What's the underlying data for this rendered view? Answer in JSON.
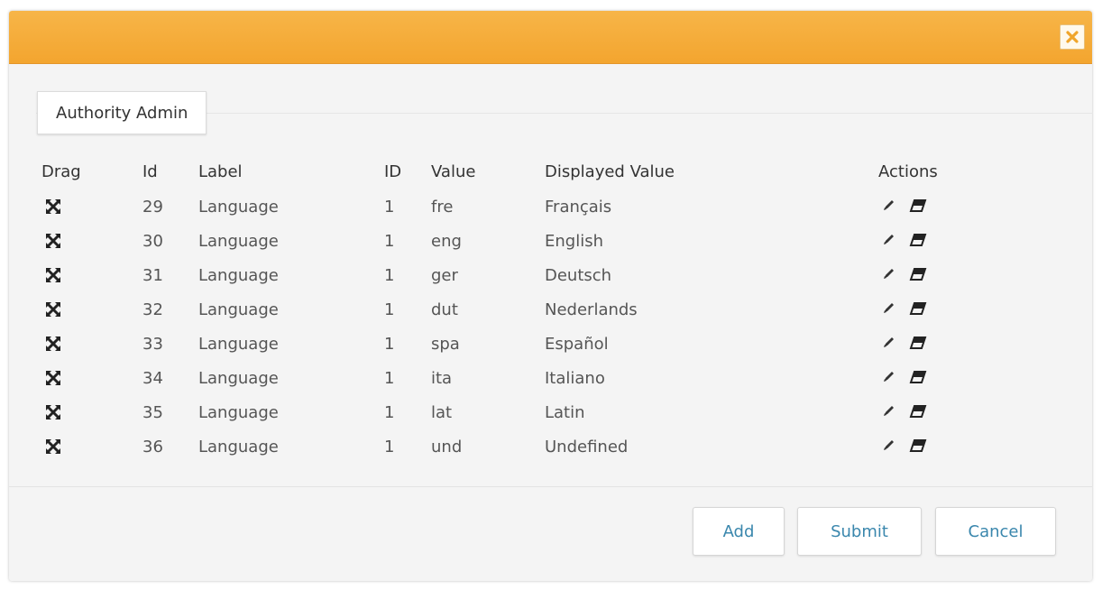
{
  "dialog": {
    "close_icon": "close-icon",
    "colors": {
      "titlebar": "#f4a933",
      "link": "#3a87ad"
    }
  },
  "tab": {
    "label": "Authority Admin"
  },
  "table": {
    "headers": {
      "drag": "Drag",
      "id": "Id",
      "label": "Label",
      "ID": "ID",
      "value": "Value",
      "displayed_value": "Displayed Value",
      "actions": "Actions"
    },
    "rows": [
      {
        "id": "29",
        "label": "Language",
        "ID": "1",
        "value": "fre",
        "displayed_value": "Français"
      },
      {
        "id": "30",
        "label": "Language",
        "ID": "1",
        "value": "eng",
        "displayed_value": "English"
      },
      {
        "id": "31",
        "label": "Language",
        "ID": "1",
        "value": "ger",
        "displayed_value": "Deutsch"
      },
      {
        "id": "32",
        "label": "Language",
        "ID": "1",
        "value": "dut",
        "displayed_value": "Nederlands"
      },
      {
        "id": "33",
        "label": "Language",
        "ID": "1",
        "value": "spa",
        "displayed_value": "Español"
      },
      {
        "id": "34",
        "label": "Language",
        "ID": "1",
        "value": "ita",
        "displayed_value": "Italiano"
      },
      {
        "id": "35",
        "label": "Language",
        "ID": "1",
        "value": "lat",
        "displayed_value": "Latin"
      },
      {
        "id": "36",
        "label": "Language",
        "ID": "1",
        "value": "und",
        "displayed_value": "Undefined"
      }
    ],
    "icons": {
      "drag": "move-arrows-icon",
      "edit": "pencil-icon",
      "delete": "eraser-icon"
    }
  },
  "buttons": {
    "add": "Add",
    "submit": "Submit",
    "cancel": "Cancel"
  }
}
